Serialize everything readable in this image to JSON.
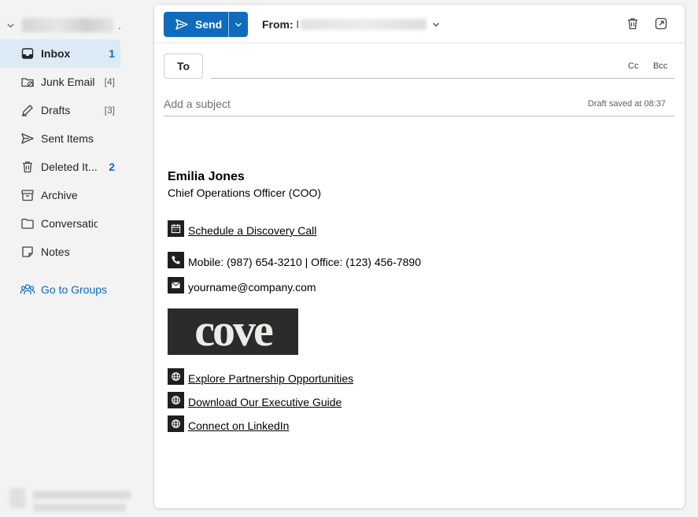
{
  "sidebar": {
    "items": [
      {
        "label": "Inbox",
        "count": "1",
        "icon": "inbox-icon"
      },
      {
        "label": "Junk Email",
        "count": "[4]",
        "icon": "junk-icon"
      },
      {
        "label": "Drafts",
        "count": "[3]",
        "icon": "drafts-icon"
      },
      {
        "label": "Sent Items",
        "count": "",
        "icon": "send-icon"
      },
      {
        "label": "Deleted It...",
        "count": "2",
        "icon": "trash-icon"
      },
      {
        "label": "Archive",
        "count": "",
        "icon": "archive-icon"
      },
      {
        "label": "Conversation...",
        "count": "",
        "icon": "folder-icon"
      },
      {
        "label": "Notes",
        "count": "",
        "icon": "note-icon"
      }
    ],
    "groups_label": "Go to Groups"
  },
  "toolbar": {
    "send_label": "Send",
    "from_label": "From:",
    "from_value": "l"
  },
  "compose": {
    "to_label": "To",
    "cc_label": "Cc",
    "bcc_label": "Bcc",
    "subject_placeholder": "Add a subject",
    "draft_status": "Draft saved at 08:37"
  },
  "signature": {
    "name": "Emilia Jones",
    "role": "Chief Operations Officer (COO)",
    "schedule_link": "Schedule a Discovery Call",
    "phone_text": "Mobile: (987) 654-3210 | Office: (123) 456-7890",
    "email_text": "yourname@company.com",
    "logo_text": "cove",
    "links": [
      "Explore Partnership Opportunities",
      "Download Our Executive Guide",
      "Connect on LinkedIn"
    ]
  },
  "colors": {
    "accent": "#0f6cbd",
    "active_bg": "#dceaf6",
    "icon_square": "#1f1f1f"
  }
}
